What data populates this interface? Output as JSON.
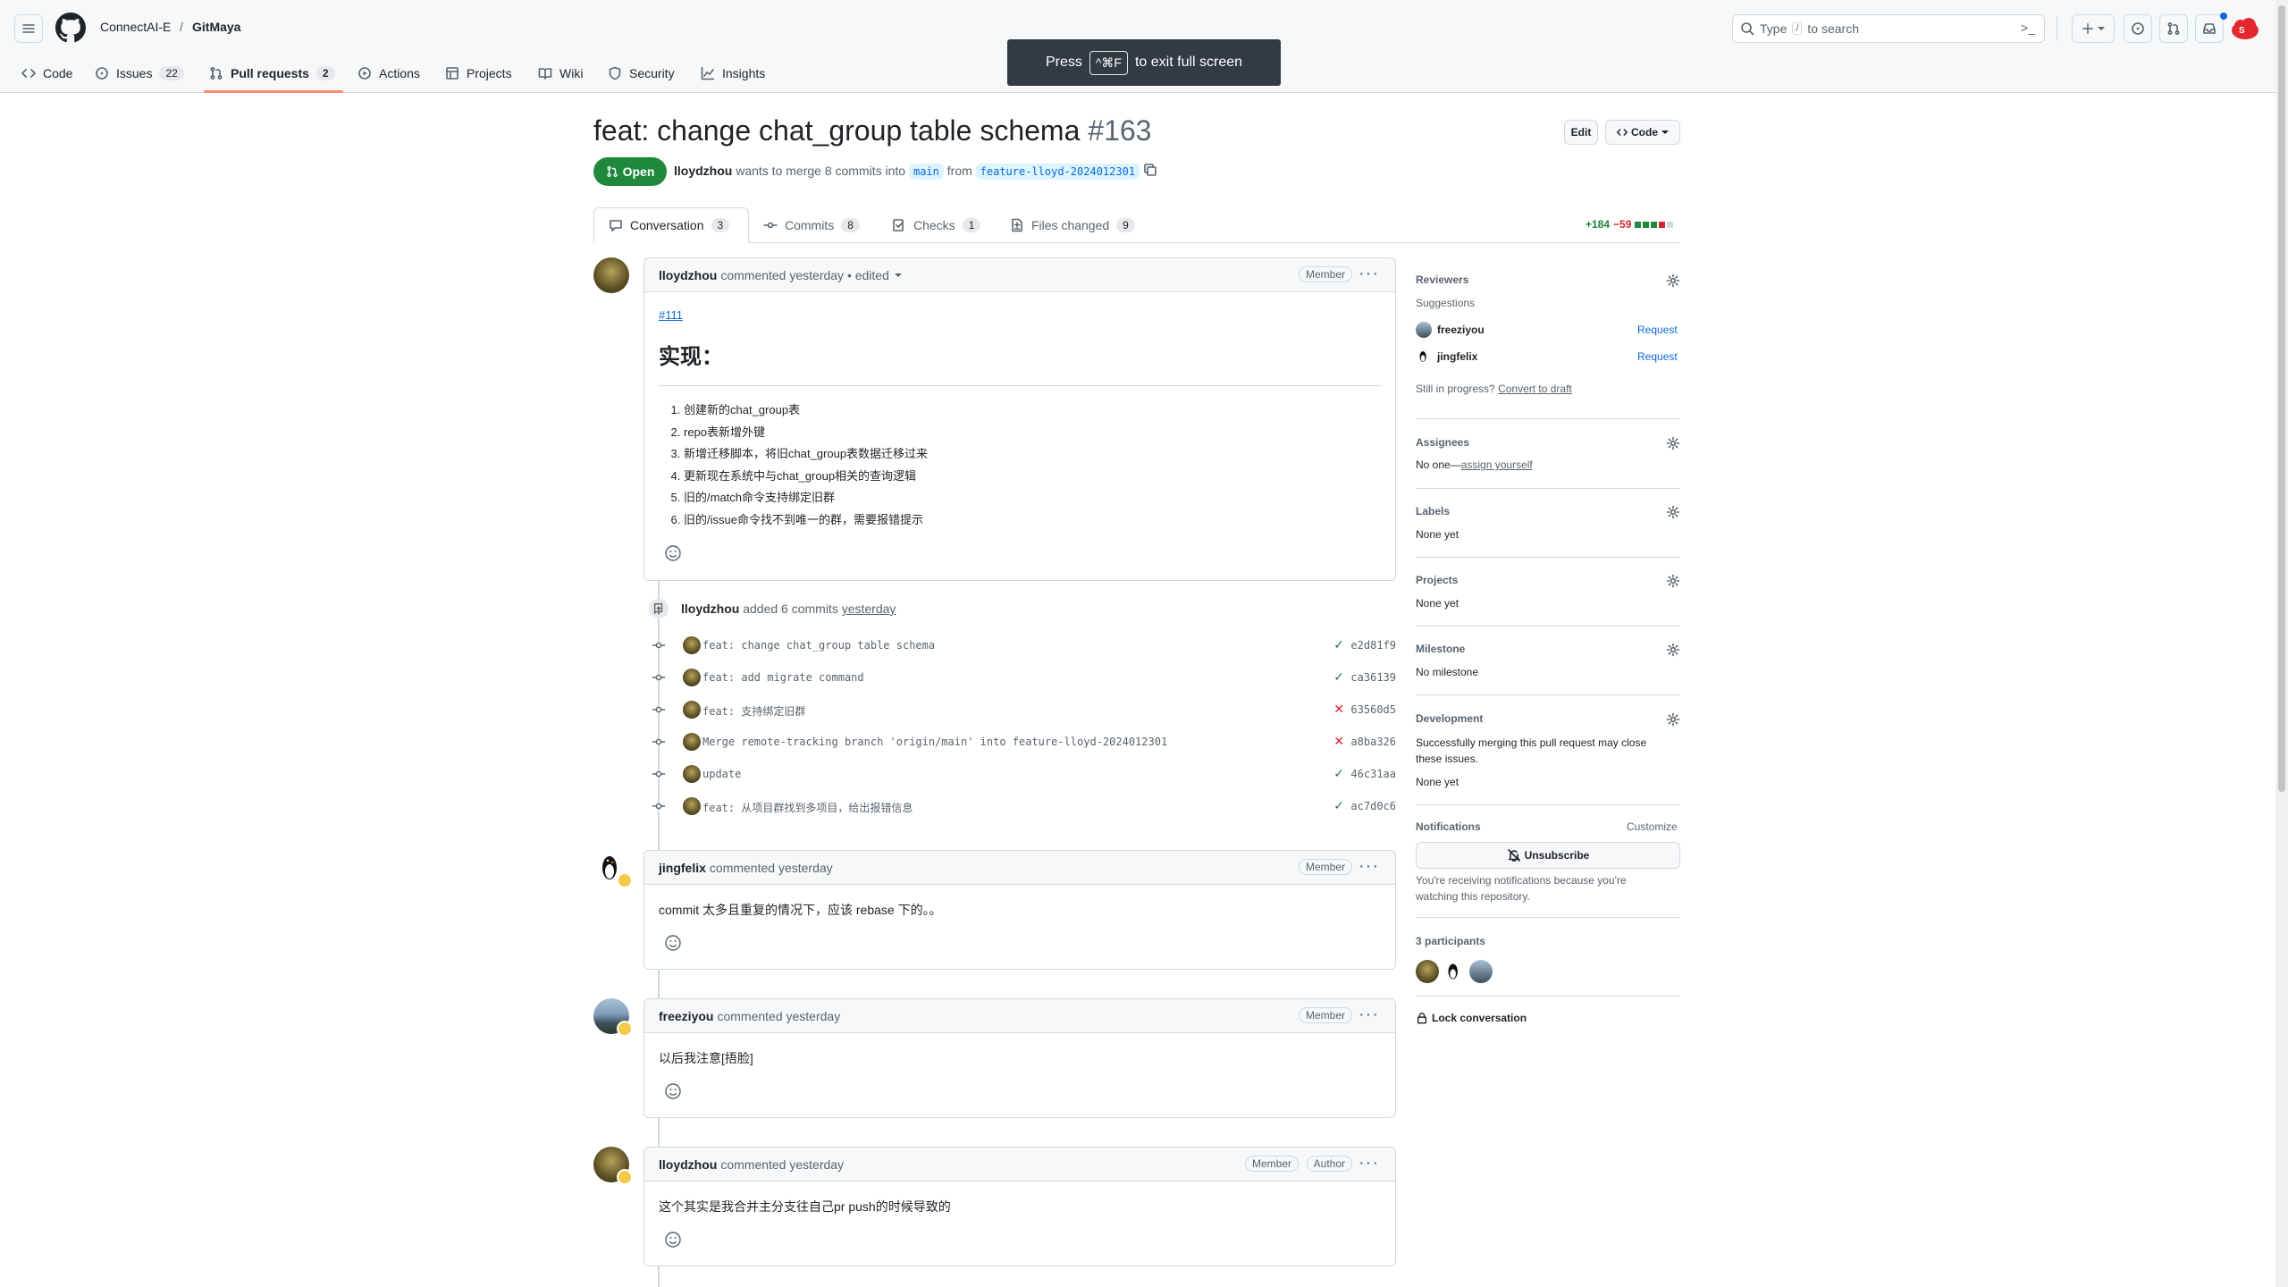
{
  "header": {
    "owner": "ConnectAI-E",
    "separator": "/",
    "repo": "GitMaya",
    "search": {
      "pre": "Type",
      "key": "/",
      "post": "to search"
    }
  },
  "nav": [
    {
      "label": "Code",
      "icon": "code-icon"
    },
    {
      "label": "Issues",
      "count": "22",
      "icon": "issue-icon"
    },
    {
      "label": "Pull requests",
      "count": "2",
      "icon": "pull-request-icon",
      "active": true
    },
    {
      "label": "Actions",
      "icon": "play-icon"
    },
    {
      "label": "Projects",
      "icon": "table-icon"
    },
    {
      "label": "Wiki",
      "icon": "book-icon"
    },
    {
      "label": "Security",
      "icon": "shield-icon"
    },
    {
      "label": "Insights",
      "icon": "graph-icon"
    }
  ],
  "toast": {
    "pre": "Press",
    "key": "^⌘F",
    "post": "to exit full screen"
  },
  "pr": {
    "title": "feat: change chat_group table schema",
    "number": "#163",
    "state": "Open",
    "author": "lloydzhou",
    "meta_mid": "wants to merge 8 commits into",
    "base": "main",
    "from": "from",
    "head": "feature-lloyd-2024012301",
    "edit_label": "Edit",
    "code_label": "Code",
    "diff_add": "+184",
    "diff_del": "−59"
  },
  "tabs": [
    {
      "label": "Conversation",
      "count": "3",
      "icon": "comment-icon"
    },
    {
      "label": "Commits",
      "count": "8",
      "icon": "commit-icon"
    },
    {
      "label": "Checks",
      "count": "1",
      "icon": "checklist-icon"
    },
    {
      "label": "Files changed",
      "count": "9",
      "icon": "file-diff-icon"
    }
  ],
  "main_comment": {
    "author": "lloydzhou",
    "text": "commented yesterday • edited",
    "role": "Member",
    "issue_link": "#111",
    "heading": "实现：",
    "items": [
      "创建新的chat_group表",
      "repo表新增外键",
      "新增迁移脚本，将旧chat_group表数据迁移过来",
      "更新现在系统中与chat_group相关的查询逻辑",
      "旧的/match命令支持绑定旧群",
      "旧的/issue命令找不到唯一的群，需要报错提示"
    ]
  },
  "commits_event": {
    "author": "lloydzhou",
    "text": "added 6 commits",
    "when": "yesterday"
  },
  "commits": [
    {
      "msg": "feat: change chat_group table schema",
      "sha": "e2d81f9",
      "ok": true
    },
    {
      "msg": "feat: add migrate command",
      "sha": "ca36139",
      "ok": true
    },
    {
      "msg": "feat: 支持绑定旧群",
      "sha": "63560d5",
      "ok": false
    },
    {
      "msg": "Merge remote-tracking branch 'origin/main' into feature-lloyd-2024012301",
      "sha": "a8ba326",
      "ok": false
    },
    {
      "msg": "update",
      "sha": "46c31aa",
      "ok": true
    },
    {
      "msg": "feat: 从项目群找到多项目，给出报错信息",
      "sha": "ac7d0c6",
      "ok": true
    }
  ],
  "comments": [
    {
      "author": "jingfelix",
      "text": "commented yesterday",
      "role": "Member",
      "body": "commit 太多且重复的情况下，应该 rebase 下的。。"
    },
    {
      "author": "freeziyou",
      "text": "commented yesterday",
      "role": "Member",
      "body": "以后我注意[捂脸]"
    },
    {
      "author": "lloydzhou",
      "text": "commented yesterday",
      "role": "Member",
      "role2": "Author",
      "body": "这个其实是我合并主分支往自己pr push的时候导致的"
    }
  ],
  "sidebar": {
    "reviewers": {
      "title": "Reviewers",
      "suggestions": "Suggestions",
      "people": [
        {
          "name": "freeziyou",
          "action": "Request"
        },
        {
          "name": "jingfelix",
          "action": "Request"
        }
      ],
      "progress": "Still in progress?",
      "draft": "Convert to draft"
    },
    "assignees": {
      "title": "Assignees",
      "value": "No one—",
      "link": "assign yourself"
    },
    "labels": {
      "title": "Labels",
      "value": "None yet"
    },
    "projects": {
      "title": "Projects",
      "value": "None yet"
    },
    "milestone": {
      "title": "Milestone",
      "value": "No milestone"
    },
    "development": {
      "title": "Development",
      "desc": "Successfully merging this pull request may close these issues.",
      "value": "None yet"
    },
    "notifications": {
      "title": "Notifications",
      "customize": "Customize",
      "button": "Unsubscribe",
      "desc": "You're receiving notifications because you're watching this repository."
    },
    "participants": {
      "title": "3 participants"
    },
    "lock": "Lock conversation"
  },
  "colors": {
    "accent": "#0969da",
    "open": "#1f883d",
    "danger": "#d1242f",
    "bg_subtle": "#f6f8fa",
    "border": "#d1d9e0"
  }
}
